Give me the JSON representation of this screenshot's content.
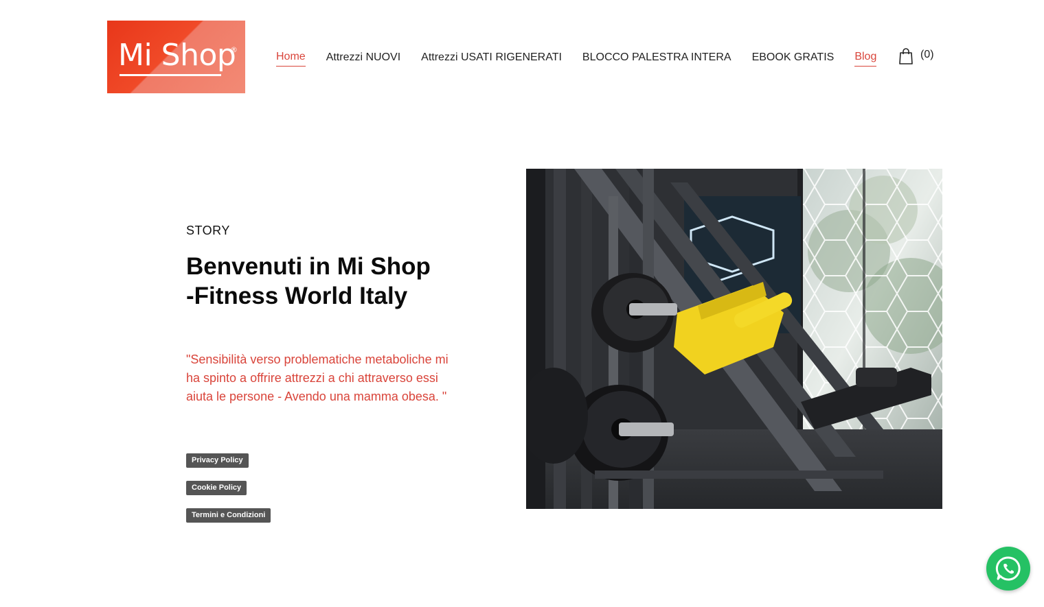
{
  "logo": {
    "text": "Mi Shop",
    "reg": "®"
  },
  "nav": {
    "items": [
      {
        "label": "Home"
      },
      {
        "label": "Attrezzi NUOVI"
      },
      {
        "label": "Attrezzi USATI RIGENERATI"
      },
      {
        "label": "BLOCCO PALESTRA INTERA"
      },
      {
        "label": "EBOOK GRATIS"
      },
      {
        "label": "Blog"
      }
    ]
  },
  "cart": {
    "count": "(0)",
    "icon": "shopping-bag-icon"
  },
  "story": {
    "label": "STORY",
    "headline_line1": "Benvenuti in Mi Shop",
    "headline_line2": "-Fitness World Italy",
    "quote": "\"Sensibilità verso problematiche metaboliche mi ha spinto a offrire attrezzi a chi attraverso essi aiuta le persone - Avendo una mamma obesa. \""
  },
  "links": {
    "privacy": "Privacy Policy",
    "cookie": "Cookie Policy",
    "terms": "Termini e Condizioni"
  },
  "colors": {
    "accent": "#d9443a",
    "logo_bg": "#e8371a",
    "badge_bg": "#555555",
    "whatsapp": "#25c164"
  },
  "whatsapp": {
    "icon": "whatsapp-icon"
  }
}
